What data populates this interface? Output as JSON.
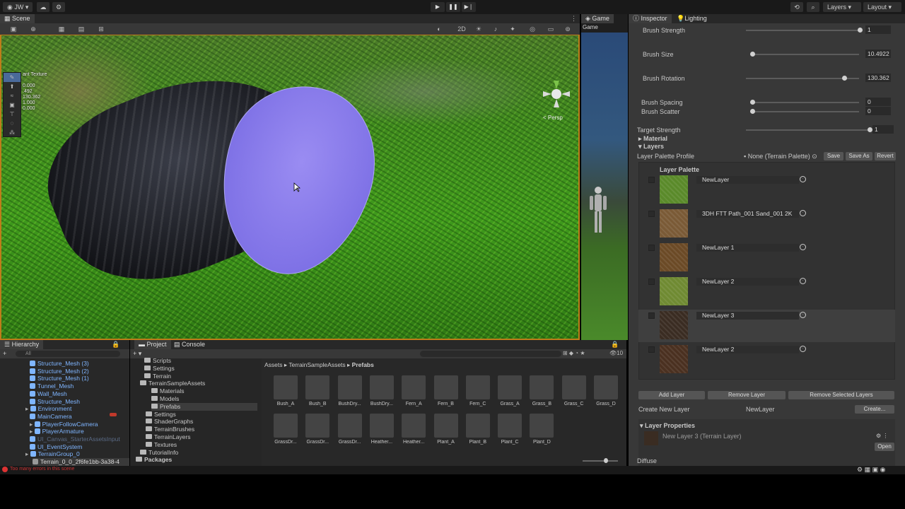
{
  "topbar": {
    "account": "JW",
    "layers_dropdown": "Layers",
    "layout_dropdown": "Layout"
  },
  "scene": {
    "tab_label": "Scene",
    "overlay_title": "ant Texture",
    "readout": [
      "0.000",
      ".492",
      "130.362",
      "1.000",
      "0.000"
    ],
    "persp_label": "< Persp",
    "btn_2d": "2D"
  },
  "game": {
    "tab_label": "Game",
    "display_label": "Game"
  },
  "hierarchy": {
    "tab_label": "Hierarchy",
    "search_placeholder": "All",
    "rows": [
      "Structure_Mesh (3)",
      "Structure_Mesh (2)",
      "Structure_Mesh (1)",
      "Tunnel_Mesh",
      "Wall_Mesh",
      "Structure_Mesh",
      "Environment",
      "MainCamera",
      "PlayerFollowCamera",
      "PlayerArmature",
      "UI_Canvas_StarterAssetsInput",
      "UI_EventSystem",
      "TerrainGroup_0",
      "Terrain_0_0_2f6fe1bb-3a38-4"
    ]
  },
  "project": {
    "tab_label": "Project",
    "console_tab_label": "Console",
    "tree": [
      "Scripts",
      "Settings",
      "Terrain",
      "TerrainSampleAssets",
      "Materials",
      "Models",
      "Prefabs",
      "Settings",
      "ShaderGraphs",
      "TerrainBrushes",
      "TerrainLayers",
      "Textures",
      "TutorialInfo",
      "Packages"
    ],
    "breadcrumb": [
      "Assets",
      "TerrainSampleAssets",
      "Prefabs"
    ],
    "assets": [
      "Bush_A",
      "Bush_B",
      "BushDry...",
      "BushDry...",
      "Fern_A",
      "Fern_B",
      "Fern_C",
      "Grass_A",
      "Grass_B",
      "Grass_C",
      "Grass_D",
      "GrassDr...",
      "GrassDr...",
      "GrassDr...",
      "Heather...",
      "Heather...",
      "Plant_A",
      "Plant_B",
      "Plant_C",
      "Plant_D"
    ],
    "count": "10"
  },
  "inspector": {
    "tab_label": "Inspector",
    "lighting_tab_label": "Lighting",
    "brush_strength_label": "Brush Strength",
    "brush_strength_value": "1",
    "brush_size_label": "Brush Size",
    "brush_size_value": "10.4922",
    "brush_rotation_label": "Brush Rotation",
    "brush_rotation_value": "130.362",
    "brush_spacing_label": "Brush Spacing",
    "brush_spacing_value": "0",
    "brush_scatter_label": "Brush Scatter",
    "brush_scatter_value": "0",
    "target_strength_label": "Target Strength",
    "target_strength_value": "1",
    "material_label": "Material",
    "layers_label": "Layers",
    "palette_profile_label": "Layer Palette Profile",
    "palette_profile_value": "None (Terrain Palette)",
    "save": "Save",
    "save_as": "Save As",
    "revert": "Revert",
    "layer_palette_title": "Layer Palette",
    "layers": [
      {
        "name": "NewLayer",
        "color": "#5a8a2a"
      },
      {
        "name": "3DH FTT Path_001 Sand_001 2K",
        "color": "#7a5a36"
      },
      {
        "name": "NewLayer 1",
        "color": "#6b4a26"
      },
      {
        "name": "NewLayer 2",
        "color": "#6f8a32"
      },
      {
        "name": "NewLayer 3",
        "color": "#3a2c22"
      },
      {
        "name": "NewLayer 2",
        "color": "#4a3020"
      }
    ],
    "add_layer": "Add Layer",
    "remove_layer": "Remove Layer",
    "remove_selected": "Remove Selected Layers",
    "create_new_layer_label": "Create New Layer",
    "create_new_layer_value": "NewLayer",
    "create_button": "Create...",
    "layer_properties_label": "Layer Properties",
    "layer_properties_value": "New Layer 3 (Terrain Layer)",
    "open_button": "Open",
    "diffuse_label": "Diffuse"
  },
  "status": {
    "message": "Too many errors in this scene"
  }
}
